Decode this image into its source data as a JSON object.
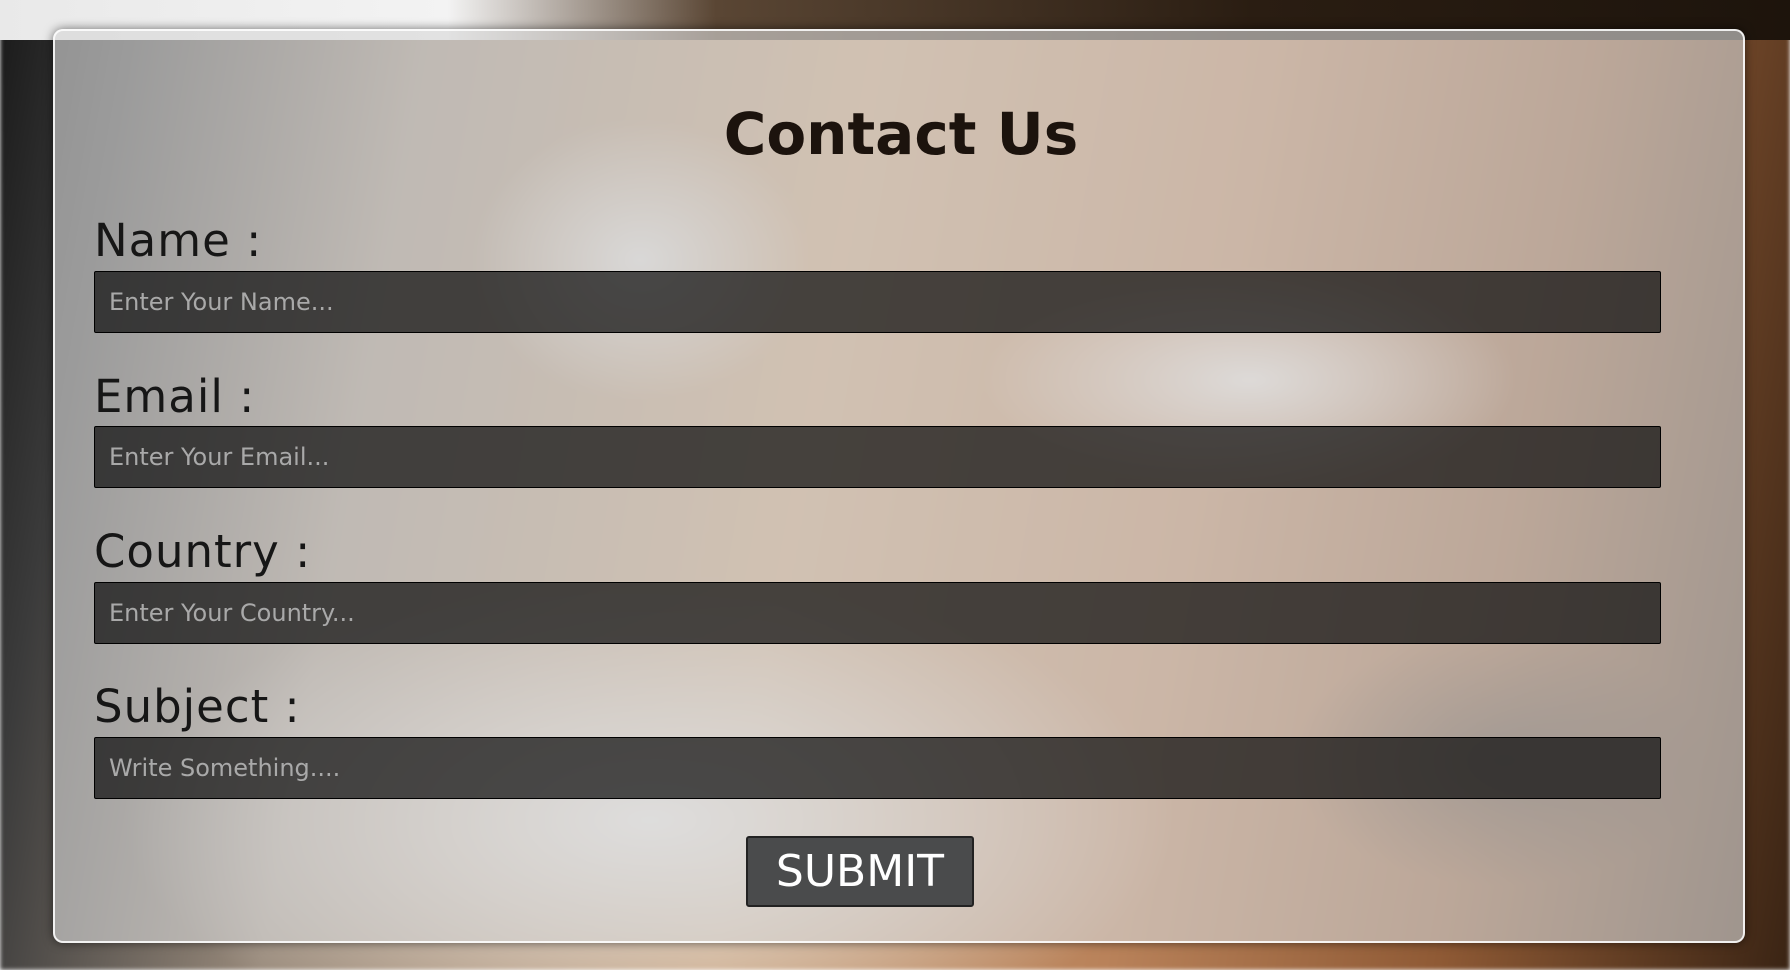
{
  "form": {
    "title": "Contact Us",
    "fields": [
      {
        "label": "Name :",
        "placeholder": "Enter Your Name..."
      },
      {
        "label": "Email :",
        "placeholder": "Enter Your Email..."
      },
      {
        "label": "Country :",
        "placeholder": "Enter Your Country..."
      },
      {
        "label": "Subject :",
        "placeholder": "Write Something...."
      }
    ],
    "submit_label": "SUBMIT"
  },
  "colors": {
    "title_text": "#1c130d",
    "input_background": "#1a1a1a",
    "button_background": "#4a4b4c",
    "button_text": "#ffffff"
  }
}
